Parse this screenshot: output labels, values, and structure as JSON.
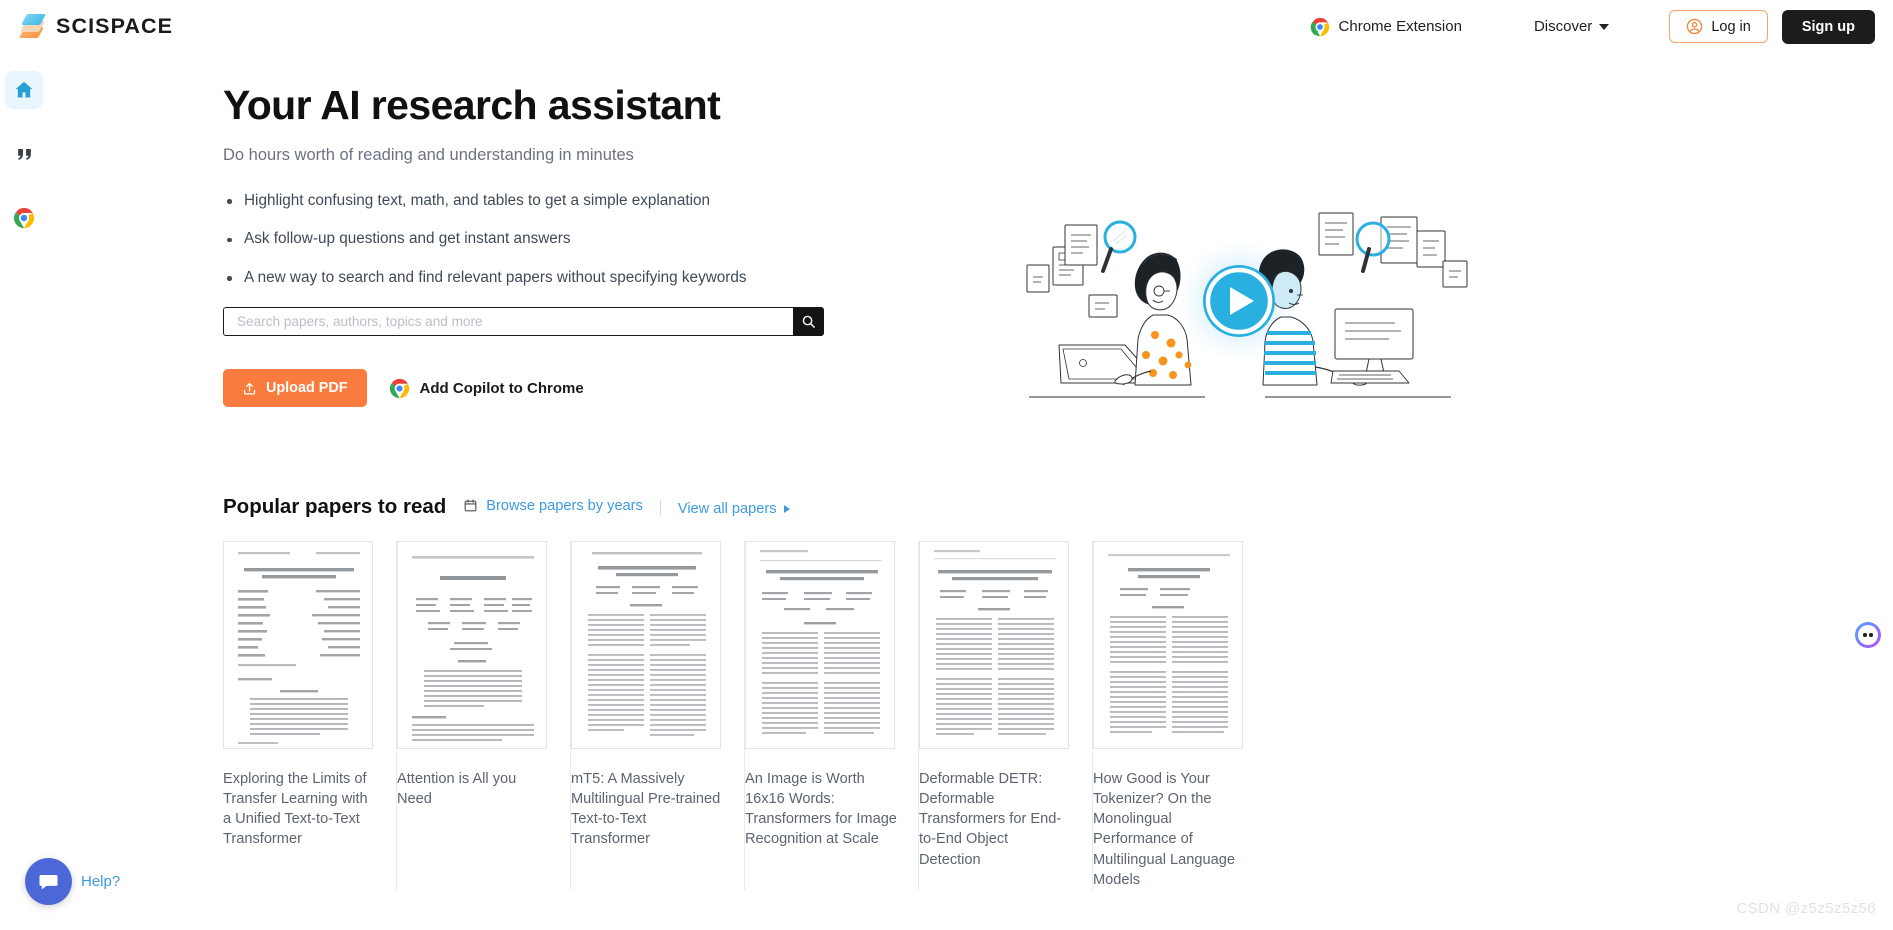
{
  "header": {
    "logo_text": "SCISPACE",
    "logo_icon": "layers-icon",
    "chrome_extension_label": "Chrome Extension",
    "chrome_extension_icon": "chrome-icon",
    "discover_label": "Discover",
    "discover_caret_icon": "chevron-down-icon",
    "login_label": "Log in",
    "login_icon": "user-circle-icon",
    "signup_label": "Sign up",
    "login_border_color": "#f5a46a",
    "signup_bg_color": "#1c1c1c"
  },
  "sidebar": {
    "items": [
      {
        "name": "home",
        "icon": "home-icon",
        "active": true
      },
      {
        "name": "citations",
        "icon": "quote-icon",
        "active": false
      },
      {
        "name": "chrome",
        "icon": "chrome-icon",
        "active": false
      }
    ],
    "active_bg_color": "#eaf6fd"
  },
  "hero": {
    "title": "Your AI research assistant",
    "subtitle": "Do hours worth of reading and understanding in minutes",
    "features": [
      "Highlight confusing text, math, and tables to get a simple explanation",
      "Ask follow-up questions and get instant answers",
      "A new way to search and find relevant papers without specifying keywords"
    ],
    "search": {
      "placeholder": "Search papers, authors, topics and more",
      "value": "",
      "button_icon": "search-icon",
      "button_bg_color": "#141414"
    },
    "upload_button": {
      "label": "Upload PDF",
      "icon": "upload-icon",
      "bg_color": "#f97b3d"
    },
    "add_copilot": {
      "label": "Add Copilot to Chrome",
      "icon": "chrome-icon"
    },
    "illustration": {
      "name": "research-video-illustration",
      "play_button_icon": "play-icon",
      "accent_color": "#29b0e0"
    }
  },
  "papers": {
    "section_title": "Popular papers to read",
    "browse_label": "Browse papers by years",
    "browse_icon": "calendar-icon",
    "view_all_label": "View all papers",
    "view_all_icon": "triangle-right-icon",
    "link_color": "#3d9ae0",
    "items": [
      {
        "title": "Exploring the Limits of Transfer Learning with a Unified Text-to-Text Transformer",
        "thumb_title": "Exploring the Limits of Transfer Learning with a Unified Text-to-Text Transformer"
      },
      {
        "title": "Attention is All you Need",
        "thumb_title": "Attention Is All You Need"
      },
      {
        "title": "mT5: A Massively Multilingual Pre-trained Text-to-Text Transformer",
        "thumb_title": "mT5: A Massively Multilingual Pre-trained Text-to-Text Transformer"
      },
      {
        "title": "An Image is Worth 16x16 Words: Transformers for Image Recognition at Scale",
        "thumb_title": "An Image Is Worth 16x16 Words: Transformers For Image Recognition At Scale"
      },
      {
        "title": "Deformable DETR: Deformable Transformers for End-to-End Object Detection",
        "thumb_title": "Deformable DETR: Deformable Transformers For End-to-End Object Detection"
      },
      {
        "title": "How Good is Your Tokenizer? On the Monolingual Performance of Multilingual Language Models",
        "thumb_title": "How Good is Your Tokenizer? On the Monolingual Performance of Multilingual Language Models"
      }
    ]
  },
  "help_widget": {
    "label": "Help?",
    "icon": "chat-bubble-icon",
    "bg_color": "#4c68d7"
  },
  "float_widget": {
    "icon": "dots-circle-icon"
  },
  "watermark": {
    "text": "CSDN @z5z5z5z56"
  }
}
